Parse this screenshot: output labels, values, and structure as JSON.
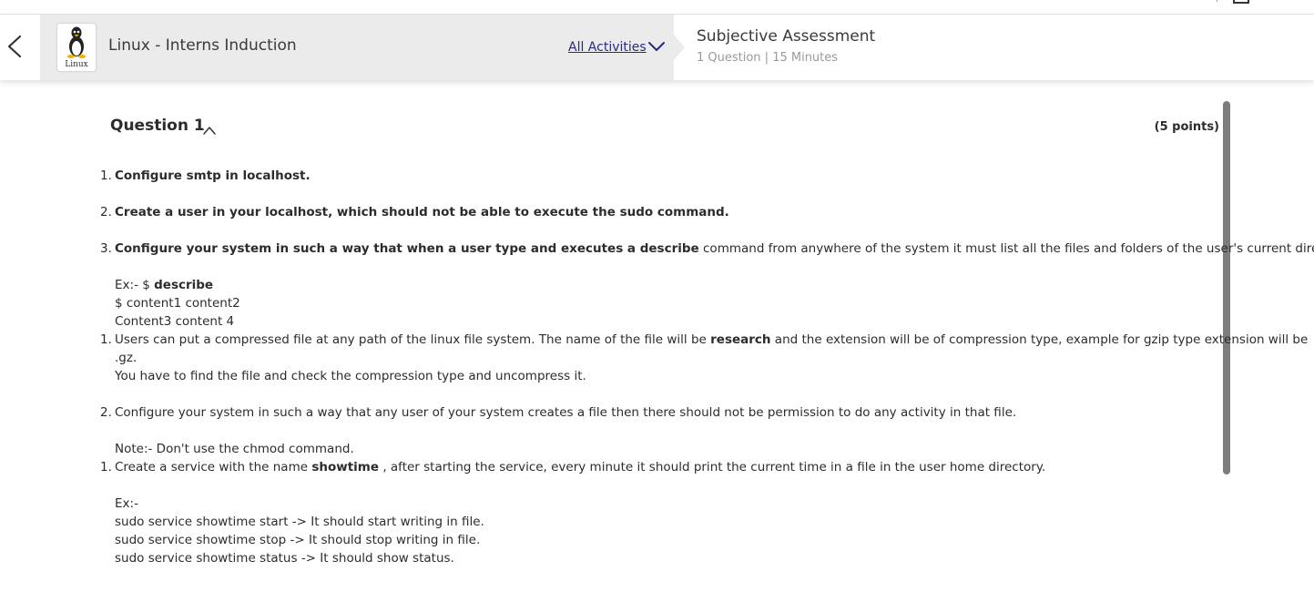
{
  "header": {
    "course_title": "Linux - Interns Induction",
    "logo_text": "Linux",
    "all_activities": "All Activities",
    "assessment_title": "Subjective Assessment",
    "assessment_meta": "1 Question | 15 Minutes"
  },
  "question": {
    "heading": "Question 1",
    "points": "(5 points)",
    "lines": [
      {
        "num": "1.",
        "parts": [
          {
            "b": "Configure smtp in localhost."
          }
        ]
      },
      {
        "num": "2.",
        "parts": [
          {
            "b": "Create a user in your localhost, which should not be able to execute the sudo command."
          }
        ]
      },
      {
        "num": "3.",
        "parts": [
          {
            "b": "Configure your system in such a way that when a user type and executes a describe"
          },
          {
            "t": " command from anywhere of the system it must list all the files and folders of the user's current directory."
          }
        ]
      },
      {
        "num": "",
        "parts": [
          {
            "t": "Ex:- $ "
          },
          {
            "b": "describe"
          }
        ]
      },
      {
        "num": "",
        "parts": [
          {
            "t": "$  content1 content2"
          }
        ]
      },
      {
        "num": "",
        "parts": [
          {
            "t": "Content3 content 4"
          }
        ]
      },
      {
        "num": "1.",
        "parts": [
          {
            "t": "Users can put a compressed file at any path of the linux file system. The name of the file will be "
          },
          {
            "b": "research"
          },
          {
            "t": " and the extension will be of compression type, example for gzip type extension will be"
          }
        ]
      },
      {
        "num": "",
        "parts": [
          {
            "t": ".gz."
          }
        ]
      },
      {
        "num": "",
        "parts": [
          {
            "t": "You have to find the file and check the compression type and uncompress it."
          }
        ]
      },
      {
        "num": "2.",
        "parts": [
          {
            "t": "Configure your system in such a way that any user of your system creates a file then there should not be permission to do any activity in that file."
          }
        ]
      },
      {
        "num": "",
        "parts": [
          {
            "t": "Note:- Don't use the chmod command."
          }
        ]
      },
      {
        "num": "1.",
        "parts": [
          {
            "t": "Create a service with the name "
          },
          {
            "b": "showtime"
          },
          {
            "t": " , after starting the service, every minute it should print the current time in a file in the user home directory."
          }
        ]
      },
      {
        "num": "",
        "parts": [
          {
            "t": "Ex:-"
          }
        ]
      },
      {
        "num": "",
        "parts": [
          {
            "t": "sudo service showtime start   -> It should start writing in file."
          }
        ]
      },
      {
        "num": "",
        "parts": [
          {
            "t": "sudo service showtime stop   -> It should stop writing in file."
          }
        ]
      },
      {
        "num": "",
        "parts": [
          {
            "t": "sudo service showtime status -> It should show status."
          }
        ]
      }
    ]
  },
  "colors": {
    "link": "#2a2a86",
    "panel": "#ebebeb",
    "scrollbar": "#7d7d7d",
    "muted": "#9a9a9a"
  },
  "icons": [
    "back-chevron-icon",
    "linux-tux-icon",
    "chevron-down-icon",
    "caret-up-icon"
  ]
}
